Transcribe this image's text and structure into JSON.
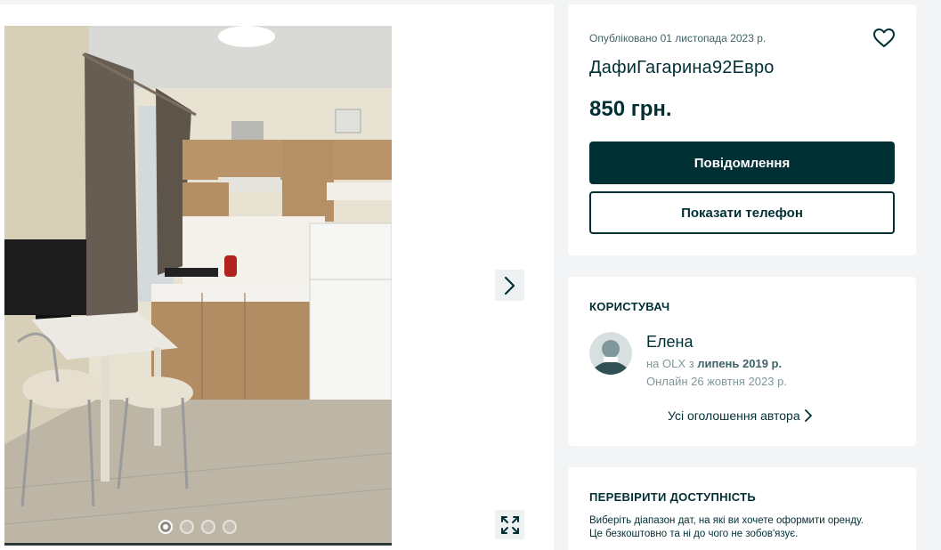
{
  "gallery": {
    "photo_alt": "Kitchen photo",
    "slide_count": 4,
    "active_slide": 1,
    "next_icon": "chevron-right-icon",
    "expand_icon": "expand-icon"
  },
  "listing": {
    "published": "Опубліковано 01 листопада 2023 р.",
    "title": "ДафиГагарина92Евро",
    "price": "850 грн.",
    "message_button": "Повідомлення",
    "phone_button": "Показати телефон",
    "favorite_icon": "heart-icon"
  },
  "user": {
    "section_title": "КОРИСТУВАЧ",
    "name": "Елена",
    "since_prefix": "на OLX з ",
    "since_date": "липень 2019 р.",
    "online": "Онлайн 26 жовтня 2023 р.",
    "all_ads_link": "Усі оголошення автора"
  },
  "availability": {
    "section_title": "ПЕРЕВІРИТИ ДОСТУПНІСТЬ",
    "line1": "Виберіть діапазон дат, на які ви хочете оформити оренду.",
    "line2": "Це безкоштовно та ні до чого не зобов'язує."
  },
  "colors": {
    "brand_dark": "#002f34",
    "page_bg": "#f2f4f5",
    "muted_text": "#7f9799"
  }
}
